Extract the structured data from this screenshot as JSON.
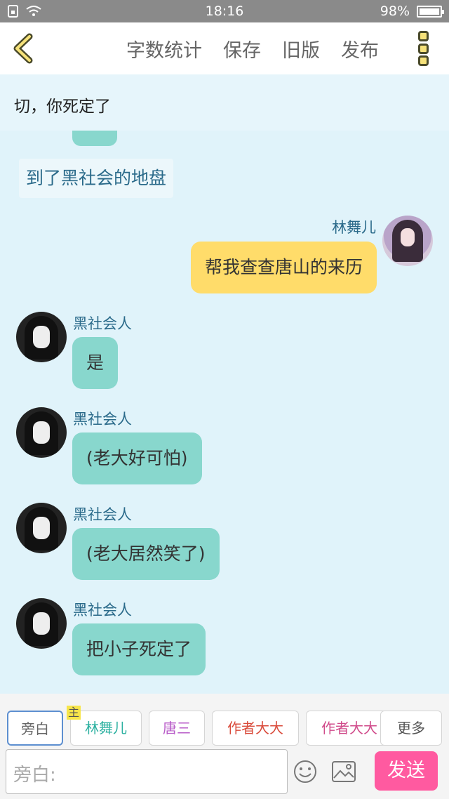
{
  "status_bar": {
    "time": "18:16",
    "battery": "98%"
  },
  "nav": {
    "items": [
      "字数统计",
      "保存",
      "旧版",
      "发布"
    ]
  },
  "chat": {
    "narration_top": "切，你死定了",
    "narration_box": "到了黑社会的地盘",
    "messages": [
      {
        "speaker": "林舞儿",
        "text": "帮我查查唐山的来历",
        "side": "right"
      },
      {
        "speaker": "黑社会人",
        "text": "是",
        "side": "left"
      },
      {
        "speaker": "黑社会人",
        "text": "(老大好可怕)",
        "side": "left"
      },
      {
        "speaker": "黑社会人",
        "text": "(老大居然笑了)",
        "side": "left"
      },
      {
        "speaker": "黑社会人",
        "text": "把小子死定了",
        "side": "left"
      }
    ]
  },
  "roles": {
    "items": [
      {
        "label": "旁白",
        "color": "#666666"
      },
      {
        "label": "林舞儿",
        "color": "#2bb0a0",
        "tag": "主"
      },
      {
        "label": "唐三",
        "color": "#b85bc8"
      },
      {
        "label": "作者大大",
        "color": "#d94a3a"
      },
      {
        "label": "作者大大",
        "color": "#d04a8a"
      },
      {
        "label": "更多",
        "color": "#555555"
      }
    ]
  },
  "composer": {
    "placeholder": "旁白:",
    "send_label": "发送"
  },
  "colors": {
    "teal_bubble": "#88d7cd",
    "yellow_bubble": "#ffdc6a",
    "send_button": "#ff5aa0",
    "background": "#e0f3fa"
  }
}
